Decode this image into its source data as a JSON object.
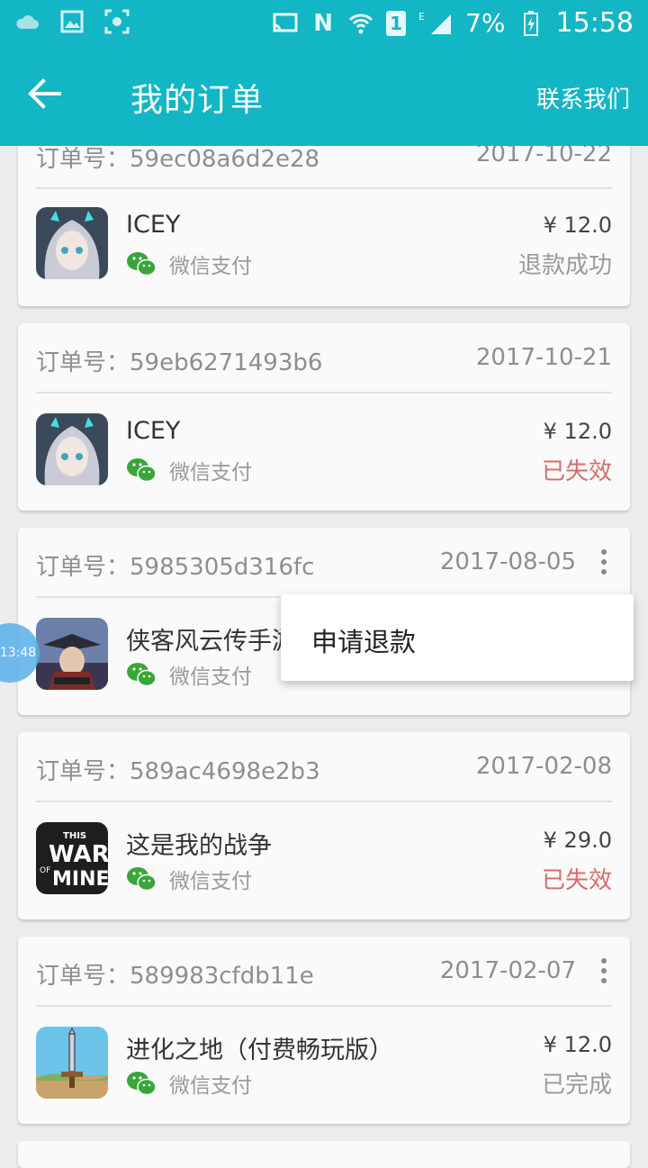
{
  "status_bar": {
    "battery": "7%",
    "time": "15:58",
    "network": "E",
    "sim": "1"
  },
  "app_bar": {
    "title": "我的订单",
    "action": "联系我们"
  },
  "orders": [
    {
      "order_label": "订单号：59ec08a6d2e28",
      "date": "2017-10-22",
      "game": "ICEY",
      "payment": "微信支付",
      "price": "¥ 12.0",
      "status": "退款成功"
    },
    {
      "order_label": "订单号：59eb6271493b6",
      "date": "2017-10-21",
      "game": "ICEY",
      "payment": "微信支付",
      "price": "¥ 12.0",
      "status": "已失效"
    },
    {
      "order_label": "订单号：5985305d316fc",
      "date": "2017-08-05",
      "game": "侠客风云传手游",
      "payment": "微信支付",
      "price": "",
      "status": ""
    },
    {
      "order_label": "订单号：589ac4698e2b3",
      "date": "2017-02-08",
      "game": "这是我的战争",
      "payment": "微信支付",
      "price": "¥ 29.0",
      "status": "已失效"
    },
    {
      "order_label": "订单号：589983cfdb11e",
      "date": "2017-02-07",
      "game": "进化之地（付费畅玩版）",
      "payment": "微信支付",
      "price": "¥ 12.0",
      "status": "已完成"
    }
  ],
  "popup_menu": {
    "item": "申请退款"
  },
  "floating_bubble": {
    "time": "13:48"
  },
  "colors": {
    "primary": "#12b6c4",
    "wechat_green": "#3aa63a",
    "status_red": "#d96a6a"
  }
}
